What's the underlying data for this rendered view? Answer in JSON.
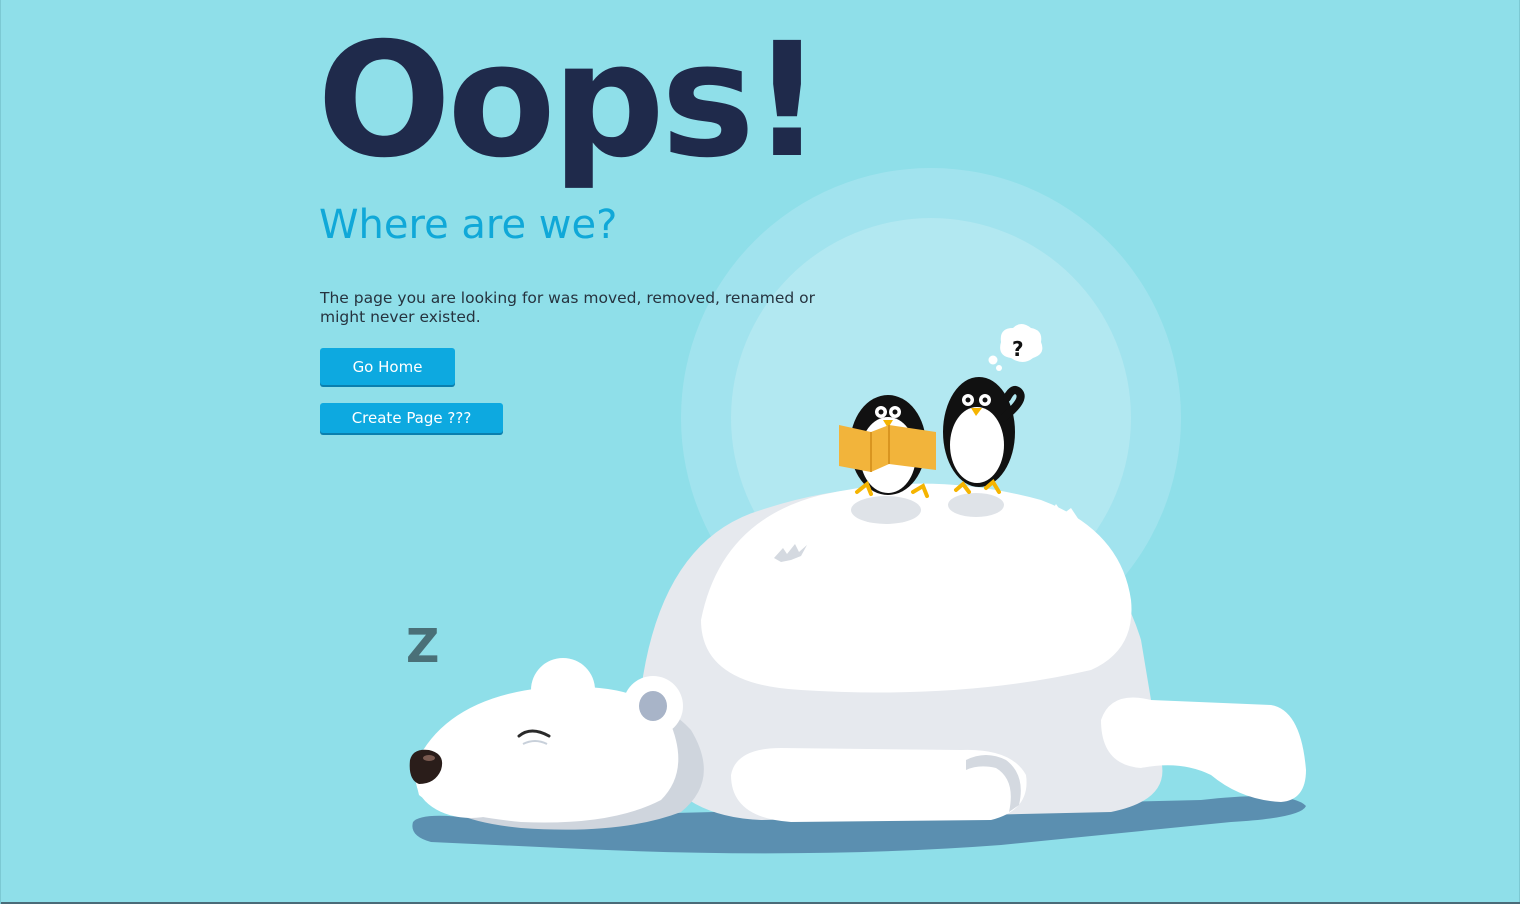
{
  "hero": {
    "title": "Oops!",
    "subtitle": "Where are we?",
    "message": "The page you are looking for was moved, removed, renamed or might never existed."
  },
  "actions": {
    "go_home_label": "Go Home",
    "create_page_label": "Create Page ???"
  },
  "illustration": {
    "sleep_letter": "Z",
    "thought_text": "?"
  },
  "colors": {
    "background": "#8fdfe9",
    "title": "#1f2a4b",
    "subtitle": "#10a8d8",
    "button": "#0da9e0"
  }
}
